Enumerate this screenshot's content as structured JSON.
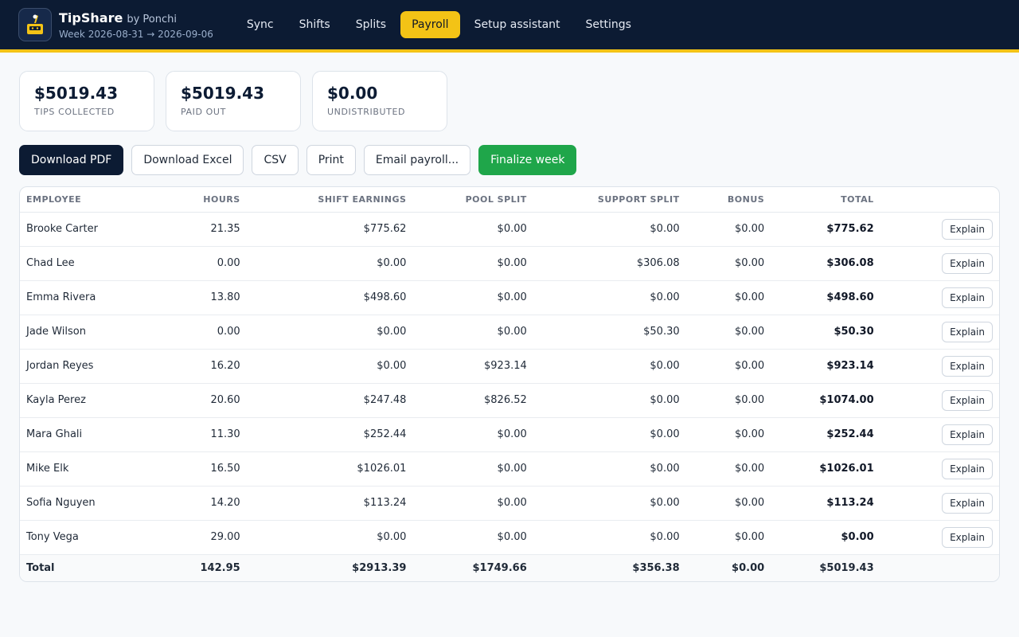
{
  "app": {
    "name": "TipShare",
    "by": "by Ponchi",
    "week": "Week 2026-08-31 → 2026-09-06",
    "logo_icon": "tip-jar-icon",
    "accent": "#f3c316",
    "header_bg": "#0c1b33"
  },
  "nav": [
    {
      "label": "Sync",
      "active": false
    },
    {
      "label": "Shifts",
      "active": false
    },
    {
      "label": "Splits",
      "active": false
    },
    {
      "label": "Payroll",
      "active": true
    },
    {
      "label": "Setup assistant",
      "active": false
    },
    {
      "label": "Settings",
      "active": false
    }
  ],
  "stats": [
    {
      "value": "$5019.43",
      "label": "TIPS COLLECTED"
    },
    {
      "value": "$5019.43",
      "label": "PAID OUT"
    },
    {
      "value": "$0.00",
      "label": "UNDISTRIBUTED"
    }
  ],
  "actions": {
    "download_pdf": "Download PDF",
    "download_excel": "Download Excel",
    "csv": "CSV",
    "print": "Print",
    "email": "Email payroll...",
    "finalize": "Finalize week"
  },
  "table": {
    "headers": [
      "EMPLOYEE",
      "HOURS",
      "SHIFT EARNINGS",
      "POOL SPLIT",
      "SUPPORT SPLIT",
      "BONUS",
      "TOTAL"
    ],
    "explain_label": "Explain",
    "rows": [
      [
        "Brooke Carter",
        "21.35",
        "$775.62",
        "$0.00",
        "$0.00",
        "$0.00",
        "$775.62"
      ],
      [
        "Chad Lee",
        "0.00",
        "$0.00",
        "$0.00",
        "$306.08",
        "$0.00",
        "$306.08"
      ],
      [
        "Emma Rivera",
        "13.80",
        "$498.60",
        "$0.00",
        "$0.00",
        "$0.00",
        "$498.60"
      ],
      [
        "Jade Wilson",
        "0.00",
        "$0.00",
        "$0.00",
        "$50.30",
        "$0.00",
        "$50.30"
      ],
      [
        "Jordan Reyes",
        "16.20",
        "$0.00",
        "$923.14",
        "$0.00",
        "$0.00",
        "$923.14"
      ],
      [
        "Kayla Perez",
        "20.60",
        "$247.48",
        "$826.52",
        "$0.00",
        "$0.00",
        "$1074.00"
      ],
      [
        "Mara Ghali",
        "11.30",
        "$252.44",
        "$0.00",
        "$0.00",
        "$0.00",
        "$252.44"
      ],
      [
        "Mike Elk",
        "16.50",
        "$1026.01",
        "$0.00",
        "$0.00",
        "$0.00",
        "$1026.01"
      ],
      [
        "Sofia Nguyen",
        "14.20",
        "$113.24",
        "$0.00",
        "$0.00",
        "$0.00",
        "$113.24"
      ],
      [
        "Tony Vega",
        "29.00",
        "$0.00",
        "$0.00",
        "$0.00",
        "$0.00",
        "$0.00"
      ]
    ],
    "total": [
      "Total",
      "142.95",
      "$2913.39",
      "$1749.66",
      "$356.38",
      "$0.00",
      "$5019.43"
    ]
  }
}
